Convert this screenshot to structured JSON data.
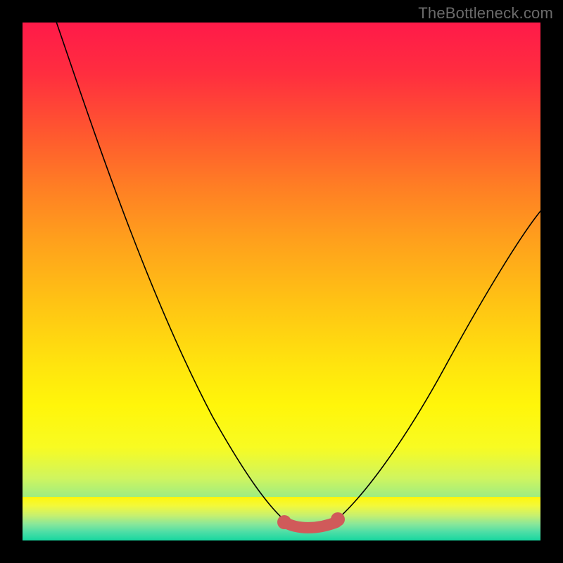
{
  "watermark": "TheBottleneck.com",
  "colors": {
    "frame": "#000000",
    "curve": "#000000",
    "highlight": "#d05a5a",
    "gradient_top": "#ff1a49",
    "gradient_bottom": "#17d7a0"
  },
  "chart_data": {
    "type": "line",
    "title": "",
    "xlabel": "",
    "ylabel": "",
    "xlim": [
      0,
      100
    ],
    "ylim": [
      0,
      100
    ],
    "x": [
      0,
      5,
      10,
      15,
      20,
      25,
      30,
      35,
      40,
      45,
      50,
      55,
      57,
      60,
      65,
      70,
      75,
      80,
      85,
      90,
      95,
      100
    ],
    "values": [
      114,
      99,
      86,
      73,
      60,
      48,
      37,
      27,
      18,
      10,
      4,
      1,
      0.5,
      1,
      3,
      8,
      15,
      23,
      32,
      42,
      53,
      63
    ],
    "highlight_range_x": [
      50,
      60
    ],
    "note": "V-shaped bottleneck curve on rainbow gradient; highlighted segment near the minimum in salmon."
  }
}
